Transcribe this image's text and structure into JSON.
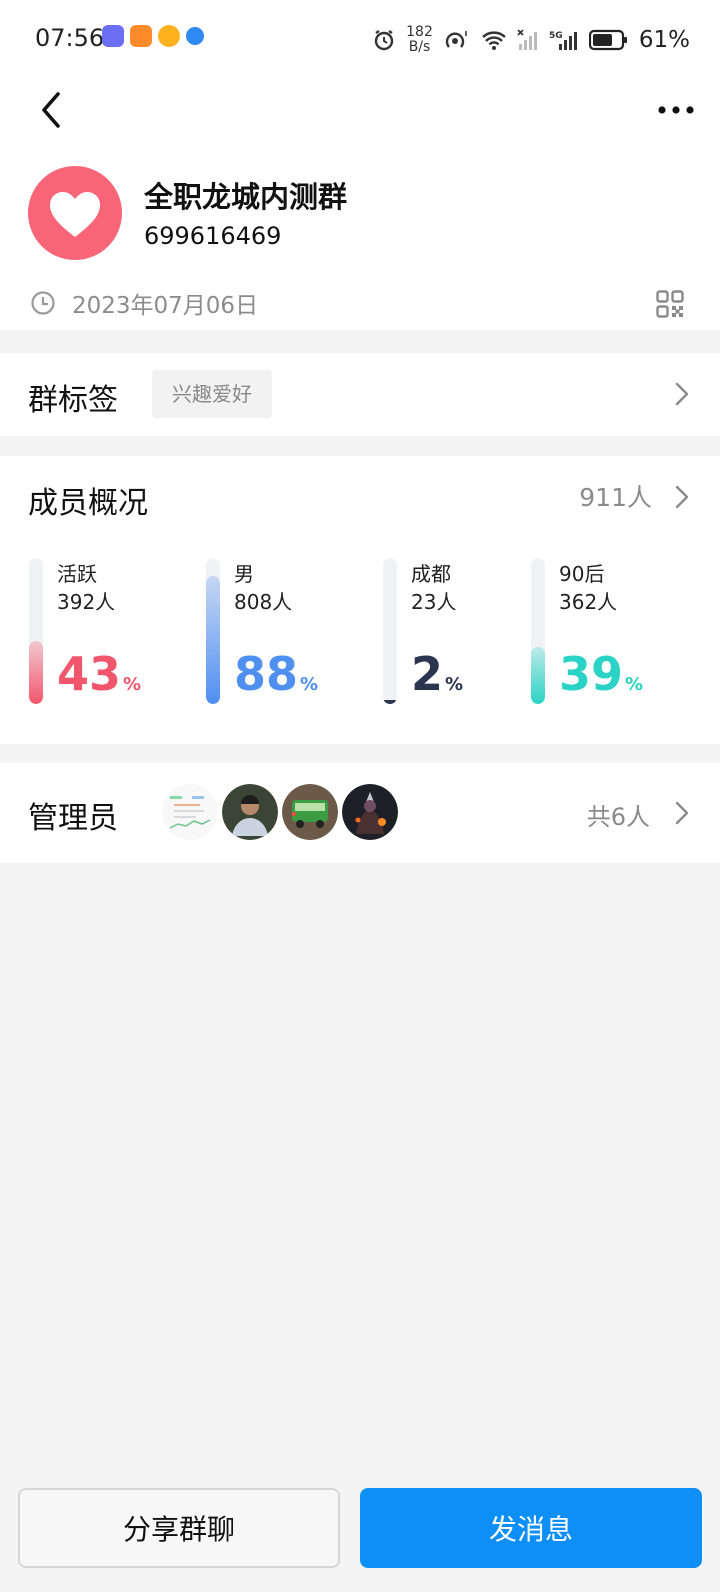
{
  "status_bar": {
    "time": "07:56",
    "net_speed_value": "182",
    "net_speed_unit": "B/s",
    "battery_pct": "61%"
  },
  "group": {
    "name": "全职龙城内测群",
    "id": "699616469",
    "created_date": "2023年07月06日"
  },
  "tags": {
    "title": "群标签",
    "items": [
      "兴趣爱好"
    ]
  },
  "members": {
    "title": "成员概况",
    "total": "911人",
    "stats": [
      {
        "label": "活跃",
        "count": "392人",
        "pct": "43",
        "sign": "%",
        "fraction": 0.43,
        "color": "#f2566c"
      },
      {
        "label": "男",
        "count": "808人",
        "pct": "88",
        "sign": "%",
        "fraction": 0.88,
        "color": "#4f8ff0"
      },
      {
        "label": "成都",
        "count": "23人",
        "pct": "2",
        "sign": "%",
        "fraction": 0.02,
        "color": "#2b3550"
      },
      {
        "label": "90后",
        "count": "362人",
        "pct": "39",
        "sign": "%",
        "fraction": 0.39,
        "color": "#2ad3c5"
      }
    ]
  },
  "admins": {
    "title": "管理员",
    "count": "共6人"
  },
  "actions": {
    "share_label": "分享群聊",
    "send_label": "发消息"
  },
  "colors": {
    "accent": "#0d8ff7",
    "avatar_bg": "#f86478"
  }
}
